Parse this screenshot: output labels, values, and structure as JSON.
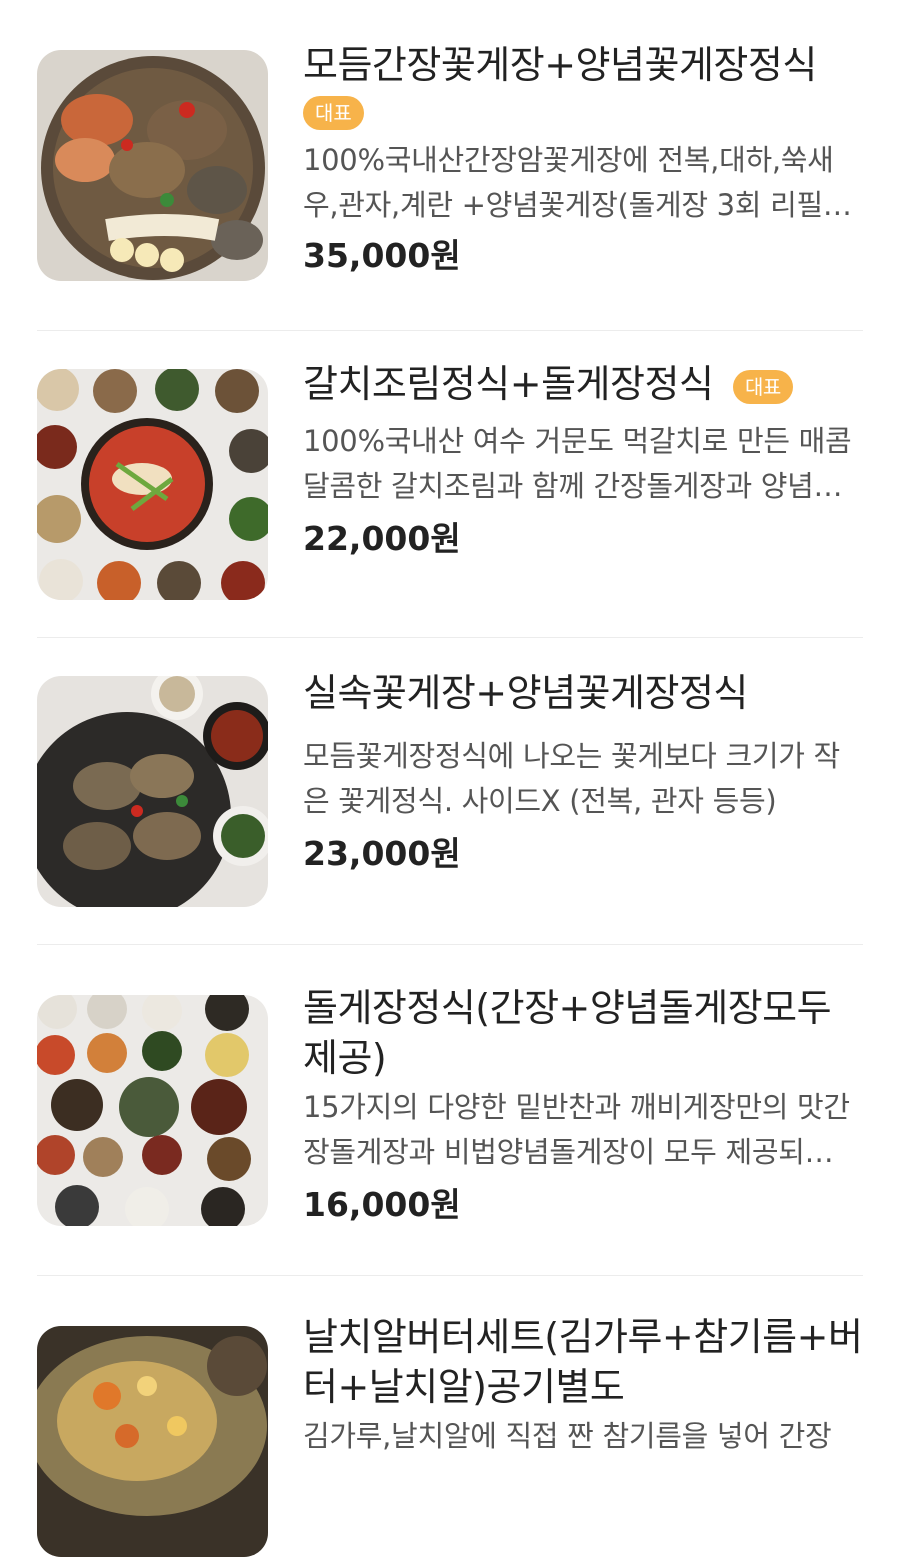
{
  "menu_items": [
    {
      "title": "모듬간장꽃게장+양념꽃게장정식",
      "badge": "대표",
      "description": "100%국내산간장암꽃게장에 전복,대하,쑥새우,관자,계란 +양념꽃게장(돌게장 3회 리필…",
      "price": "35,000원",
      "image": "crab-platter-photo"
    },
    {
      "title": "갈치조림정식+돌게장정식",
      "badge": "대표",
      "description": "100%국내산 여수 거문도 먹갈치로 만든 매콤달콤한 갈치조림과 함께 간장돌게장과 양념…",
      "price": "22,000원",
      "image": "braised-cutlassfish-set-photo"
    },
    {
      "title": "실속꽃게장+양념꽃게장정식",
      "description": "모듬꽃게장정식에 나오는 꽃게보다 크기가 작은 꽃게정식. 사이드X (전복, 관자 등등)",
      "price": "23,000원",
      "image": "crab-set-photo"
    },
    {
      "title": "돌게장정식(간장+양념돌게장모두제공)",
      "description": "15가지의 다양한 밑반찬과 깨비게장만의 맛간장돌게장과 비법양념돌게장이 모두 제공되…",
      "price": "16,000원",
      "image": "side-dishes-set-photo"
    },
    {
      "title": "날치알버터세트(김가루+참기름+버터+날치알)공기별도",
      "description": "김가루,날치알에 직접 짠 참기름을 넣어 간장",
      "image": "flying-fish-roe-butter-photo"
    }
  ],
  "colors": {
    "badge_bg": "#f7b34a",
    "divider": "#ececec"
  }
}
